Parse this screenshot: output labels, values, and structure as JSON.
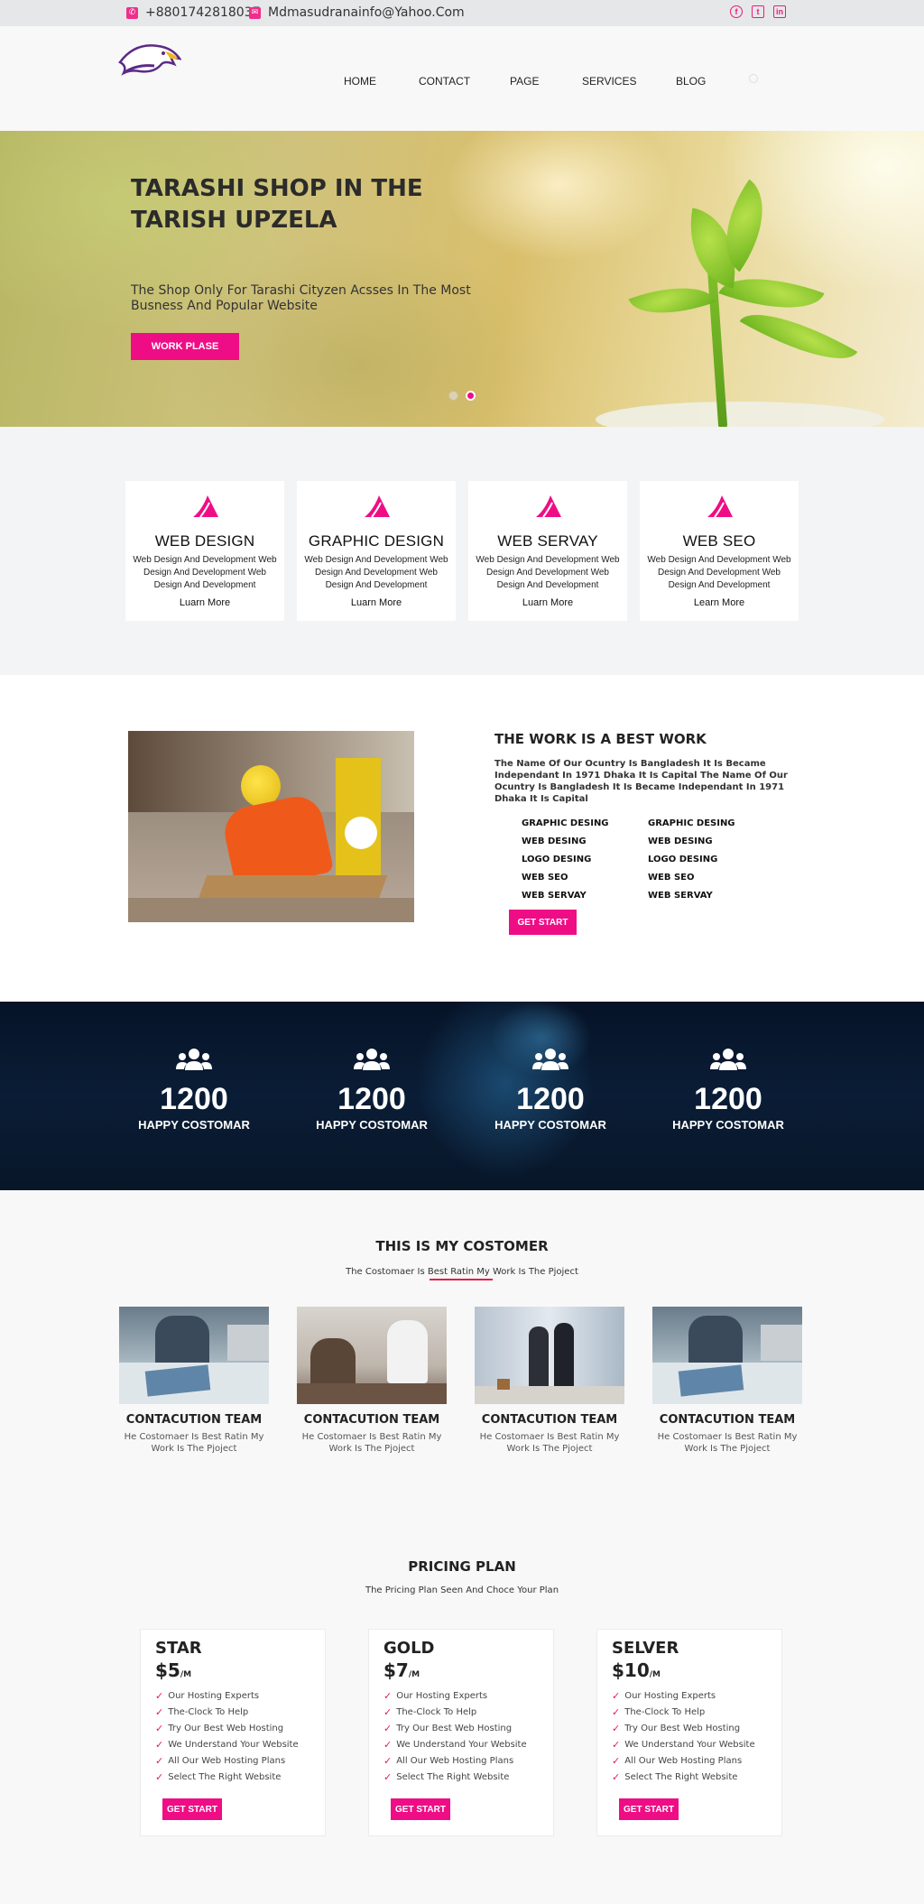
{
  "topbar": {
    "phone": "+8801742818037",
    "email": "Mdmasudranainfo@Yahoo.Com",
    "social": [
      "facebook-icon",
      "twitter-icon",
      "linkedin-icon"
    ]
  },
  "nav": {
    "items": [
      {
        "label": "HOME"
      },
      {
        "label": "CONTACT"
      },
      {
        "label": "PAGE"
      },
      {
        "label": "SERVICES"
      },
      {
        "label": "BLOG"
      }
    ]
  },
  "hero": {
    "title": "TARASHI SHOP IN THE TARISH UPZELA",
    "subtitle": "The Shop Only For Tarashi Cityzen Acsses In The Most Busness And Popular Website",
    "button": "WORK PLASE",
    "slides": 2,
    "active_slide": 2
  },
  "services": [
    {
      "title": "WEB DESIGN",
      "desc": "Web Design And Development Web Design And Development Web Design And Development",
      "link": "Luarn More"
    },
    {
      "title": "GRAPHIC DESIGN",
      "desc": "Web Design And Development Web Design And Development Web Design And Development",
      "link": "Luarn More"
    },
    {
      "title": "WEB SERVAY",
      "desc": "Web Design And Development Web Design And Development Web Design And Development",
      "link": "Luarn More"
    },
    {
      "title": "WEB SEO",
      "desc": "Web Design And Development Web Design And Development Web Design And Development",
      "link": "Learn More"
    }
  ],
  "about": {
    "title": "THE WORK IS A BEST WORK",
    "text": "The Name Of Our Ocuntry Is Bangladesh It Is Became Independant In 1971 Dhaka It Is Capital The Name Of Our Ocuntry Is Bangladesh It Is Became Independant In 1971 Dhaka It Is Capital",
    "list_left": [
      "GRAPHIC DESING",
      "WEB DESING",
      "LOGO DESING",
      "WEB SEO",
      "WEB SERVAY"
    ],
    "list_right": [
      "GRAPHIC DESING",
      "WEB DESING",
      "LOGO DESING",
      "WEB SEO",
      "WEB SERVAY"
    ],
    "button": "GET START"
  },
  "stats": [
    {
      "num": "1200",
      "label": "HAPPY COSTOMAR"
    },
    {
      "num": "1200",
      "label": "HAPPY COSTOMAR"
    },
    {
      "num": "1200",
      "label": "HAPPY COSTOMAR"
    },
    {
      "num": "1200",
      "label": "HAPPY COSTOMAR"
    }
  ],
  "customers": {
    "title": "THIS IS MY COSTOMER",
    "subtitle": "The Costomaer Is Best Ratin My Work Is The Pjoject",
    "cards": [
      {
        "title": "CONTACUTION TEAM",
        "text": "He Costomaer Is Best Ratin My Work Is The Pjoject"
      },
      {
        "title": "CONTACUTION TEAM",
        "text": "He Costomaer Is Best Ratin My Work Is The Pjoject"
      },
      {
        "title": "CONTACUTION TEAM",
        "text": "He Costomaer Is Best Ratin My Work Is The Pjoject"
      },
      {
        "title": "CONTACUTION TEAM",
        "text": "He Costomaer Is Best Ratin My Work Is The Pjoject"
      }
    ]
  },
  "pricing": {
    "title": "PRICING PLAN",
    "subtitle": "The Pricing Plan Seen And Choce Your Plan",
    "plans": [
      {
        "name": "STAR",
        "price": "$5",
        "unit": "/M",
        "features": [
          "Our Hosting Experts",
          "The-Clock To Help",
          "Try Our Best Web Hosting",
          "We Understand Your Website",
          "All Our Web Hosting Plans",
          "Select The Right Website"
        ],
        "button": "GET START"
      },
      {
        "name": "GOLD",
        "price": "$7",
        "unit": "/M",
        "features": [
          "Our Hosting Experts",
          "The-Clock To Help",
          "Try Our Best Web Hosting",
          "We Understand Your Website",
          "All Our Web Hosting Plans",
          "Select The Right Website"
        ],
        "button": "GET START"
      },
      {
        "name": "SELVER",
        "price": "$10",
        "unit": "/M",
        "features": [
          "Our Hosting Experts",
          "The-Clock To Help",
          "Try Our Best Web Hosting",
          "We Understand Your Website",
          "All Our Web Hosting Plans",
          "Select The Right Website"
        ],
        "button": "GET START"
      }
    ]
  },
  "colors": {
    "accent": "#ef0d86",
    "dark": "#061327",
    "check": "#e51b4a"
  }
}
